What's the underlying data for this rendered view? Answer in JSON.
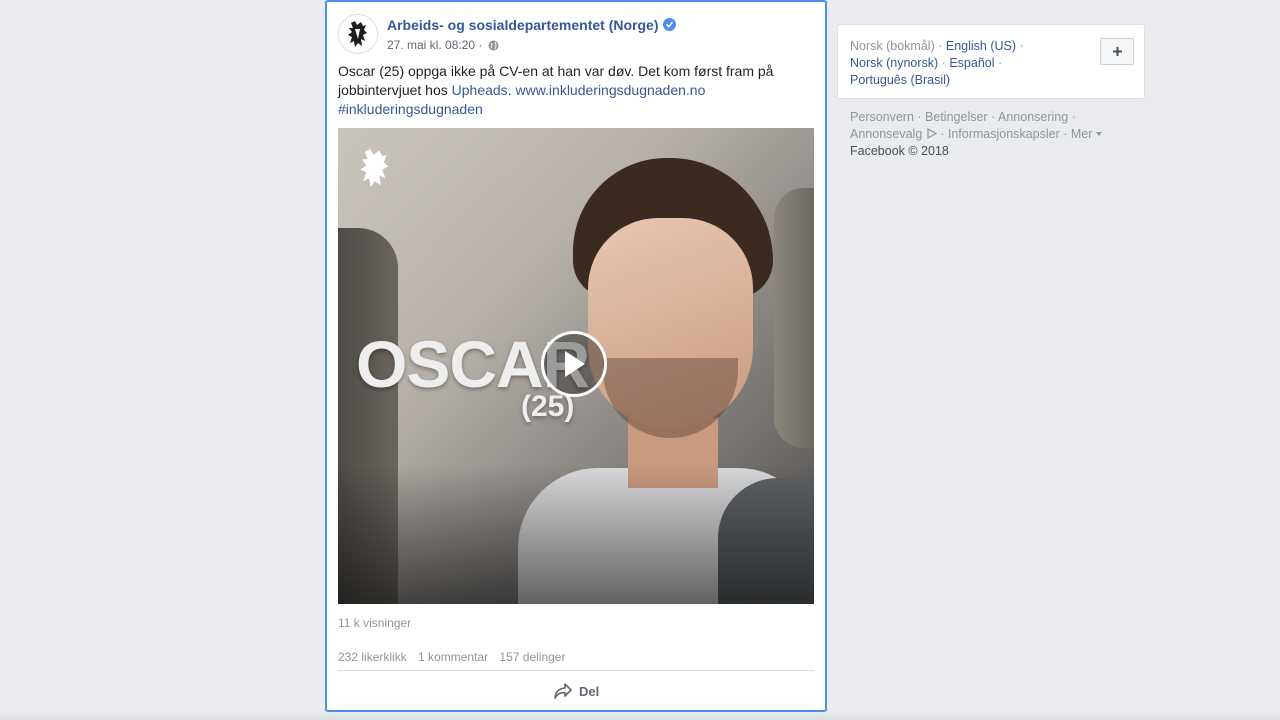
{
  "post": {
    "page_name": "Arbeids- og sosialdepartementet (Norge)",
    "timestamp": "27. mai kl. 08:20 ·",
    "text_before": "Oscar (25) oppga ikke på CV-en at han var døv. Det kom først fram på jobbintervjuet hos ",
    "link_company": "Upheads",
    "text_mid": ". ",
    "link_url": "www.inkluderingsdugnaden.no",
    "hashtag": "#inkluderingsdugnaden",
    "video": {
      "overlay_name": "OSCAR",
      "overlay_age": "(25)"
    },
    "views": "11 k visninger",
    "likes": "232 likerklikk",
    "comments": "1 kommentar",
    "shares": "157 delinger",
    "share_label": "Del"
  },
  "languages": {
    "current": "Norsk (bokmål)",
    "options": [
      "English (US)",
      "Norsk (nynorsk)",
      "Español",
      "Português (Brasil)"
    ]
  },
  "footer": {
    "links": [
      "Personvern",
      "Betingelser",
      "Annonsering",
      "Annonsevalg",
      "Informasjonskapsler",
      "Mer"
    ],
    "copyright": "Facebook © 2018"
  },
  "colors": {
    "link": "#365899",
    "selection_border": "#4a8ef0",
    "background": "#e9ebee"
  }
}
